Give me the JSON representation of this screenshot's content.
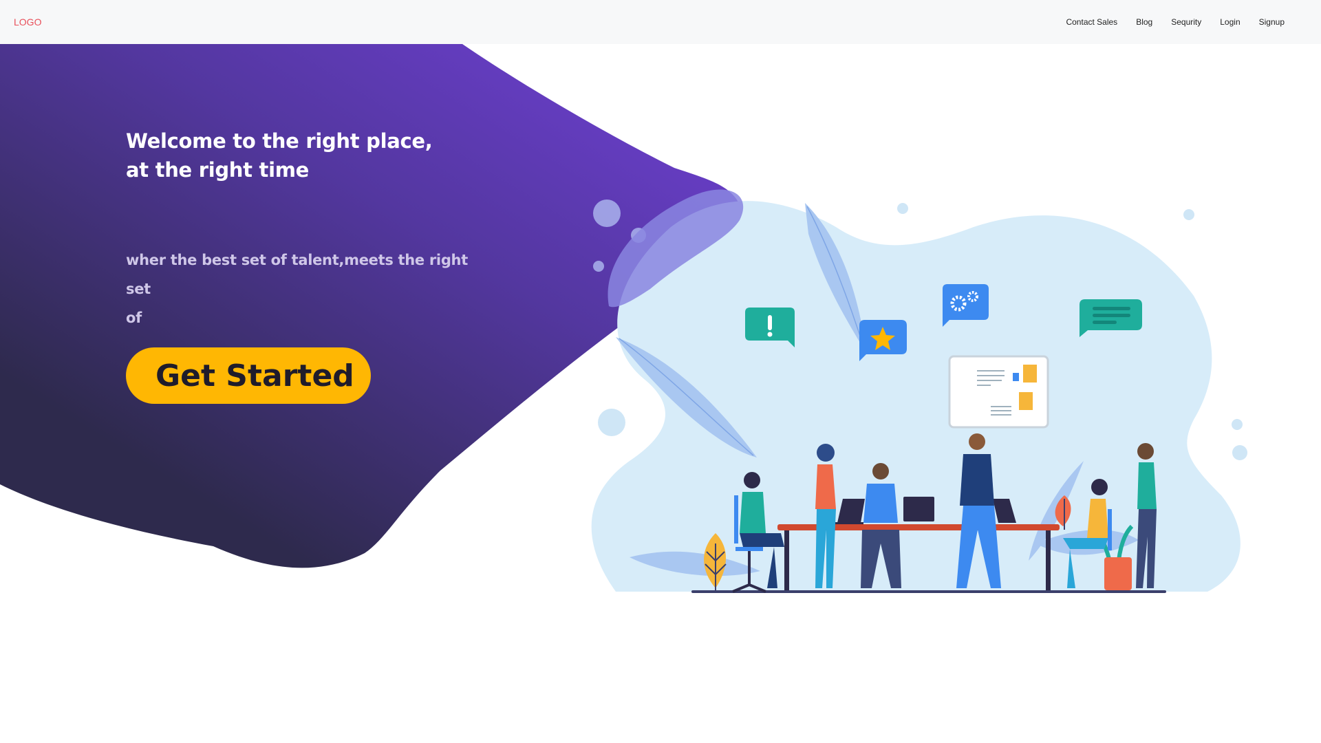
{
  "nav": {
    "logo": "LOGO",
    "links": [
      "Contact Sales",
      "Blog",
      "Sequrity",
      "Login",
      "Signup"
    ]
  },
  "hero": {
    "headline_line1": "Welcome to the right place,",
    "headline_line2": "at the right time",
    "subtext_line1": "wher the best set of talent,meets the right  set",
    "subtext_line2": "of",
    "cta_label": "Get Started"
  },
  "colors": {
    "logo": "#e8505b",
    "purple_light": "#6a3fc4",
    "purple_dark": "#2d2a4a",
    "cta": "#ffb703",
    "illustration_bg": "#d7ecf9",
    "teal_bubble": "#1fae9c",
    "blue_bubble": "#3d8af0"
  },
  "icons": {
    "alert_bubble": "exclamation-chat-icon",
    "star_bubble": "star-chat-icon",
    "gears_bubble": "gears-chat-icon",
    "text_bubble": "message-lines-chat-icon",
    "board": "sticky-notes-board-icon"
  }
}
